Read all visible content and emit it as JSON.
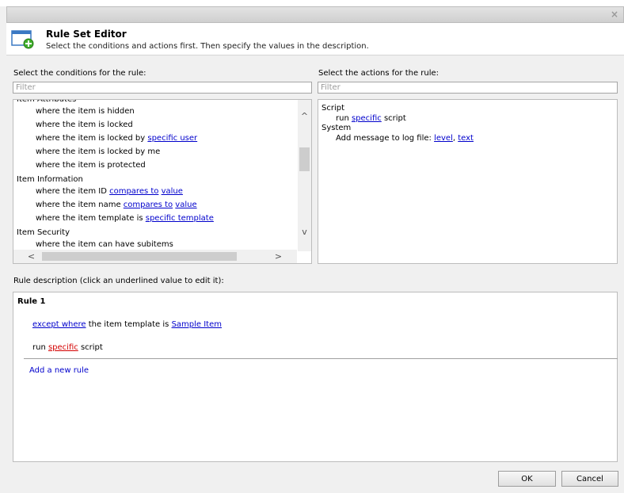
{
  "dialog": {
    "title": "Rule Set Editor",
    "subtitle": "Select the conditions and actions first. Then specify the values in the description.",
    "close_glyph": "×"
  },
  "conditions": {
    "label": "Select the conditions for the rule:",
    "filter_placeholder": "Filter",
    "groups": [
      {
        "name": "Item Attributes",
        "items": [
          {
            "parts": [
              {
                "text": "where the item is hidden"
              }
            ]
          },
          {
            "parts": [
              {
                "text": "where the item is locked"
              }
            ]
          },
          {
            "parts": [
              {
                "text": "where the item is locked by "
              },
              {
                "text": "specific user",
                "link": true
              }
            ]
          },
          {
            "parts": [
              {
                "text": "where the item is locked by me"
              }
            ]
          },
          {
            "parts": [
              {
                "text": "where the item is protected"
              }
            ]
          }
        ]
      },
      {
        "name": "Item Information",
        "items": [
          {
            "parts": [
              {
                "text": "where the item ID "
              },
              {
                "text": "compares to",
                "link": true
              },
              {
                "text": " "
              },
              {
                "text": "value",
                "link": true
              }
            ]
          },
          {
            "parts": [
              {
                "text": "where the item name "
              },
              {
                "text": "compares to",
                "link": true
              },
              {
                "text": " "
              },
              {
                "text": "value",
                "link": true
              }
            ]
          },
          {
            "parts": [
              {
                "text": "where the item template is "
              },
              {
                "text": "specific template",
                "link": true
              }
            ]
          }
        ]
      },
      {
        "name": "Item Security",
        "items": [
          {
            "parts": [
              {
                "text": "where the item can have subitems"
              }
            ]
          }
        ]
      }
    ]
  },
  "actions": {
    "label": "Select the actions for the rule:",
    "filter_placeholder": "Filter",
    "groups": [
      {
        "name": "Script",
        "items": [
          {
            "parts": [
              {
                "text": "run "
              },
              {
                "text": "specific",
                "link": true
              },
              {
                "text": " script"
              }
            ]
          }
        ]
      },
      {
        "name": "System",
        "items": [
          {
            "parts": [
              {
                "text": "Add message to log file: "
              },
              {
                "text": "level",
                "link": true
              },
              {
                "text": ", "
              },
              {
                "text": "text",
                "link": true
              }
            ]
          }
        ]
      }
    ]
  },
  "description": {
    "label": "Rule description (click an underlined value to edit it):",
    "rule_title": "Rule 1",
    "condition_link": "except where",
    "condition_text": " the item template is ",
    "condition_value": "Sample Item",
    "action_prefix": "run ",
    "action_value": "specific",
    "action_suffix": " script",
    "add_rule": "Add a new rule"
  },
  "buttons": {
    "ok": "OK",
    "cancel": "Cancel"
  },
  "icons": {
    "scroll_up": "^",
    "scroll_down": "v",
    "scroll_left": "<",
    "scroll_right": ">"
  }
}
